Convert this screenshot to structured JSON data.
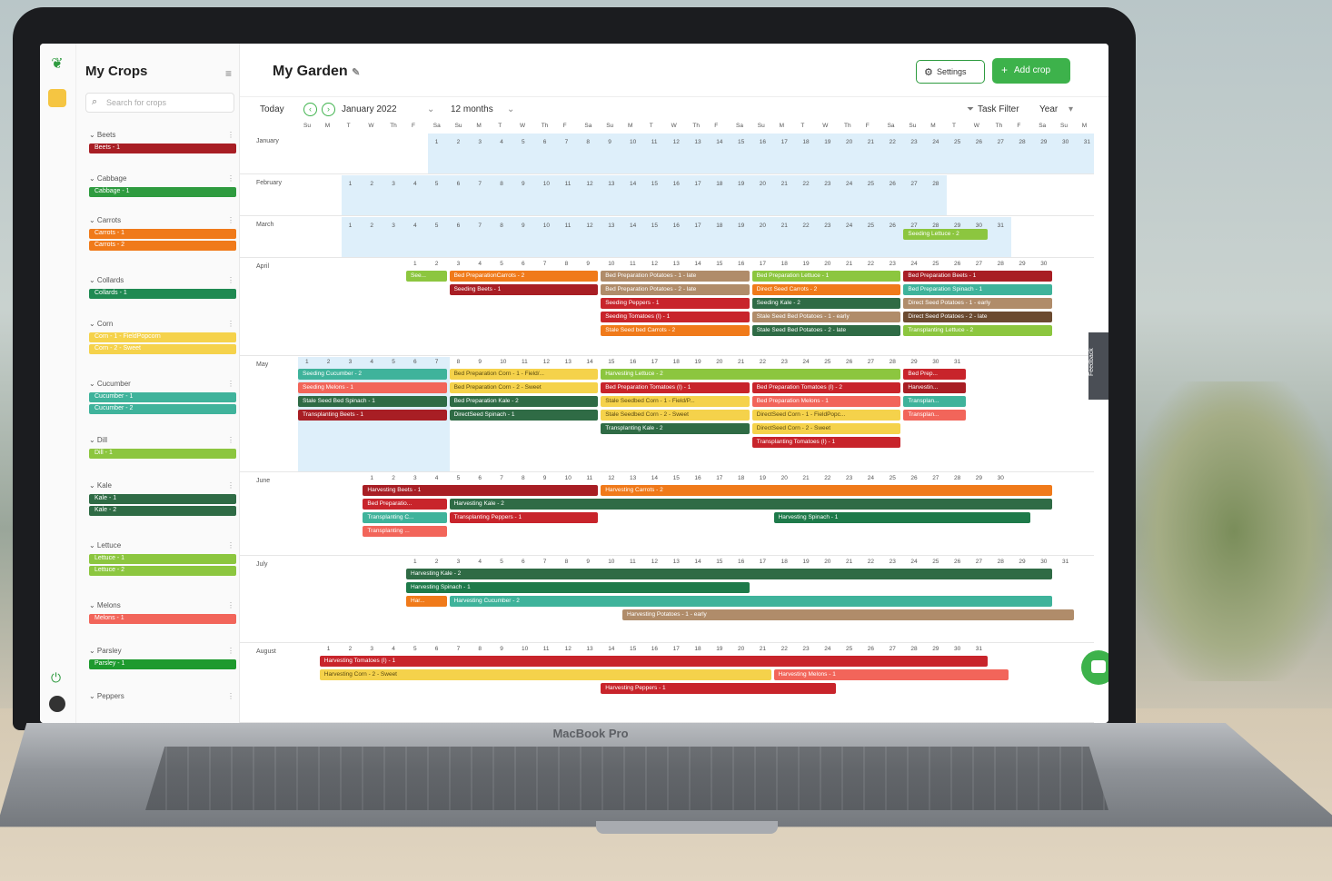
{
  "colors": {
    "red": "#c8242b",
    "dark_red": "#a81e24",
    "green": "#2e9b3f",
    "dark_green": "#2f6b45",
    "orange": "#f07a1a",
    "teal": "#3fb39b",
    "yellow": "#f5d24b",
    "light_green": "#8cc63f",
    "salmon": "#f2655a",
    "brown": "#b08c6a",
    "shade": "#deeffa"
  },
  "sidebar": {
    "title": "My Crops",
    "search_placeholder": "Search for crops",
    "groups": [
      {
        "name": "Beets",
        "chips": [
          {
            "label": "Beets - 1",
            "color": "#a81e24"
          }
        ]
      },
      {
        "name": "Cabbage",
        "chips": [
          {
            "label": "Cabbage - 1",
            "color": "#2e9b3f"
          }
        ]
      },
      {
        "name": "Carrots",
        "chips": [
          {
            "label": "Carrots - 1",
            "color": "#f07a1a"
          },
          {
            "label": "Carrots - 2",
            "color": "#f07a1a"
          }
        ]
      },
      {
        "name": "Collards",
        "chips": [
          {
            "label": "Collards - 1",
            "color": "#1f8a52"
          }
        ]
      },
      {
        "name": "Corn",
        "chips": [
          {
            "label": "Corn - 1 - FieldPopcorn",
            "color": "#f5d24b"
          },
          {
            "label": "Corn - 2 - Sweet",
            "color": "#f5d24b"
          }
        ]
      },
      {
        "name": "Cucumber",
        "chips": [
          {
            "label": "Cucumber - 1",
            "color": "#3fb39b"
          },
          {
            "label": "Cucumber - 2",
            "color": "#3fb39b"
          }
        ]
      },
      {
        "name": "Dill",
        "chips": [
          {
            "label": "Dill - 1",
            "color": "#8cc63f"
          }
        ]
      },
      {
        "name": "Kale",
        "chips": [
          {
            "label": "Kale - 1",
            "color": "#2f6b45"
          },
          {
            "label": "Kale - 2",
            "color": "#2f6b45"
          }
        ]
      },
      {
        "name": "Lettuce",
        "chips": [
          {
            "label": "Lettuce - 1",
            "color": "#8cc63f"
          },
          {
            "label": "Lettuce - 2",
            "color": "#8cc63f"
          }
        ]
      },
      {
        "name": "Melons",
        "chips": [
          {
            "label": "Melons - 1",
            "color": "#f2655a"
          }
        ]
      },
      {
        "name": "Parsley",
        "chips": [
          {
            "label": "Parsley - 1",
            "color": "#1e9a2e"
          }
        ]
      },
      {
        "name": "Peppers",
        "chips": []
      }
    ]
  },
  "header": {
    "title": "My Garden",
    "settings_label": "Settings",
    "add_label": "Add crop"
  },
  "toolbar": {
    "today": "Today",
    "month": "January 2022",
    "range": "12 months",
    "filter": "Task Filter",
    "view": "Year"
  },
  "months": [
    {
      "name": "January",
      "bars": []
    },
    {
      "name": "February",
      "bars": []
    },
    {
      "name": "March",
      "bars": [
        {
          "label": "Seeding Lettuce - 2",
          "color": "#8cc63f"
        }
      ]
    },
    {
      "name": "April",
      "bars": [
        {
          "label": "See...",
          "color": "#8cc63f"
        },
        {
          "label": "Bed PreparationCarrots - 2",
          "color": "#f07a1a"
        },
        {
          "label": "Seeding Beets - 1",
          "color": "#a81e24"
        },
        {
          "label": "Bed Preparation Potatoes - 1 - late",
          "color": "#b08c6a"
        },
        {
          "label": "Bed Preparation Potatoes - 2 - late",
          "color": "#b08c6a"
        },
        {
          "label": "Seeding Peppers - 1",
          "color": "#c8242b"
        },
        {
          "label": "Seeding Tomatoes (I) - 1",
          "color": "#c8242b"
        },
        {
          "label": "Stale Seed bed Carrots - 2",
          "color": "#f07a1a"
        },
        {
          "label": "Bed Preparation Lettuce - 1",
          "color": "#8cc63f"
        },
        {
          "label": "Direct Seed Carrots - 2",
          "color": "#f07a1a"
        },
        {
          "label": "Seeding Kale - 2",
          "color": "#2f6b45"
        },
        {
          "label": "Stale Seed Bed Potatoes - 1 - early",
          "color": "#b08c6a"
        },
        {
          "label": "Stale Seed Bed Potatoes - 2 - late",
          "color": "#2f6b45"
        },
        {
          "label": "Bed Preparation Beets - 1",
          "color": "#a81e24"
        },
        {
          "label": "Bed Preparation Spinach - 1",
          "color": "#3fb39b"
        },
        {
          "label": "Direct Seed Potatoes - 1 - early",
          "color": "#b08c6a"
        },
        {
          "label": "Direct Seed Potatoes - 2 - late",
          "color": "#6b4a30"
        },
        {
          "label": "Transplanting Lettuce - 2",
          "color": "#8cc63f"
        }
      ]
    },
    {
      "name": "May",
      "bars": [
        {
          "label": "Seeding Cucumber - 2",
          "color": "#3fb39b"
        },
        {
          "label": "Seeding Melons - 1",
          "color": "#f2655a"
        },
        {
          "label": "Stale Seed Bed Spinach - 1",
          "color": "#2f6b45"
        },
        {
          "label": "Transplanting Beets - 1",
          "color": "#a81e24"
        },
        {
          "label": "Bed Preparation Corn - 1 - Field/...",
          "color": "#f5d24b"
        },
        {
          "label": "Bed Preparation Corn - 2 - Sweet",
          "color": "#f5d24b"
        },
        {
          "label": "Bed Preparation Kale - 2",
          "color": "#2f6b45"
        },
        {
          "label": "DirectSeed Spinach - 1",
          "color": "#2f6b45"
        },
        {
          "label": "Harvesting Lettuce - 2",
          "color": "#8cc63f"
        },
        {
          "label": "Bed Preparation Tomatoes (I) - 1",
          "color": "#c8242b"
        },
        {
          "label": "Stale Seedbed Corn - 1 - Field/P...",
          "color": "#f5d24b"
        },
        {
          "label": "Stale Seedbed Corn - 2 - Sweet",
          "color": "#f5d24b"
        },
        {
          "label": "Transplanting Kale - 2",
          "color": "#2f6b45"
        },
        {
          "label": "Bed Preparation Tomatoes (I) - 2",
          "color": "#c8242b"
        },
        {
          "label": "Bed Preparation Melons - 1",
          "color": "#f2655a"
        },
        {
          "label": "DirectSeed Corn - 1 - FieldPopc...",
          "color": "#f5d24b"
        },
        {
          "label": "DirectSeed Corn - 2 - Sweet",
          "color": "#f5d24b"
        },
        {
          "label": "Transplanting Tomatoes (I) - 1",
          "color": "#c8242b"
        },
        {
          "label": "Bed Prep...",
          "color": "#c8242b"
        },
        {
          "label": "Harvestin...",
          "color": "#a81e24"
        },
        {
          "label": "Transplan...",
          "color": "#3fb39b"
        },
        {
          "label": "Transplan...",
          "color": "#f2655a"
        }
      ]
    },
    {
      "name": "June",
      "bars": [
        {
          "label": "Harvesting Beets - 1",
          "color": "#a81e24"
        },
        {
          "label": "Harvesting Carrots - 2",
          "color": "#f07a1a"
        },
        {
          "label": "Bed Preparatio...",
          "color": "#c8242b"
        },
        {
          "label": "Harvesting Kale - 2",
          "color": "#2f6b45"
        },
        {
          "label": "Transplanting C...",
          "color": "#3fb39b"
        },
        {
          "label": "Transplanting Peppers - 1",
          "color": "#c8242b"
        },
        {
          "label": "Transplanting ...",
          "color": "#f2655a"
        },
        {
          "label": "Harvesting Spinach - 1",
          "color": "#1e7a4a"
        }
      ]
    },
    {
      "name": "July",
      "bars": [
        {
          "label": "Harvesting Kale - 2",
          "color": "#2f6b45"
        },
        {
          "label": "Harvesting Spinach - 1",
          "color": "#1e7a4a"
        },
        {
          "label": "Har...",
          "color": "#f07a1a"
        },
        {
          "label": "Harvesting Cucumber - 2",
          "color": "#3fb39b"
        },
        {
          "label": "Harvesting Potatoes - 1 - early",
          "color": "#b08c6a"
        }
      ]
    },
    {
      "name": "August",
      "bars": [
        {
          "label": "Harvesting Tomatoes (I) - 1",
          "color": "#c8242b"
        },
        {
          "label": "Harvesting Corn - 2 - Sweet",
          "color": "#f5d24b"
        },
        {
          "label": "Harvesting Melons - 1",
          "color": "#f2655a"
        },
        {
          "label": "Harvesting Peppers - 1",
          "color": "#c8242b"
        }
      ]
    }
  ],
  "feedback_label": "Feedback",
  "device_label": "MacBook Pro"
}
